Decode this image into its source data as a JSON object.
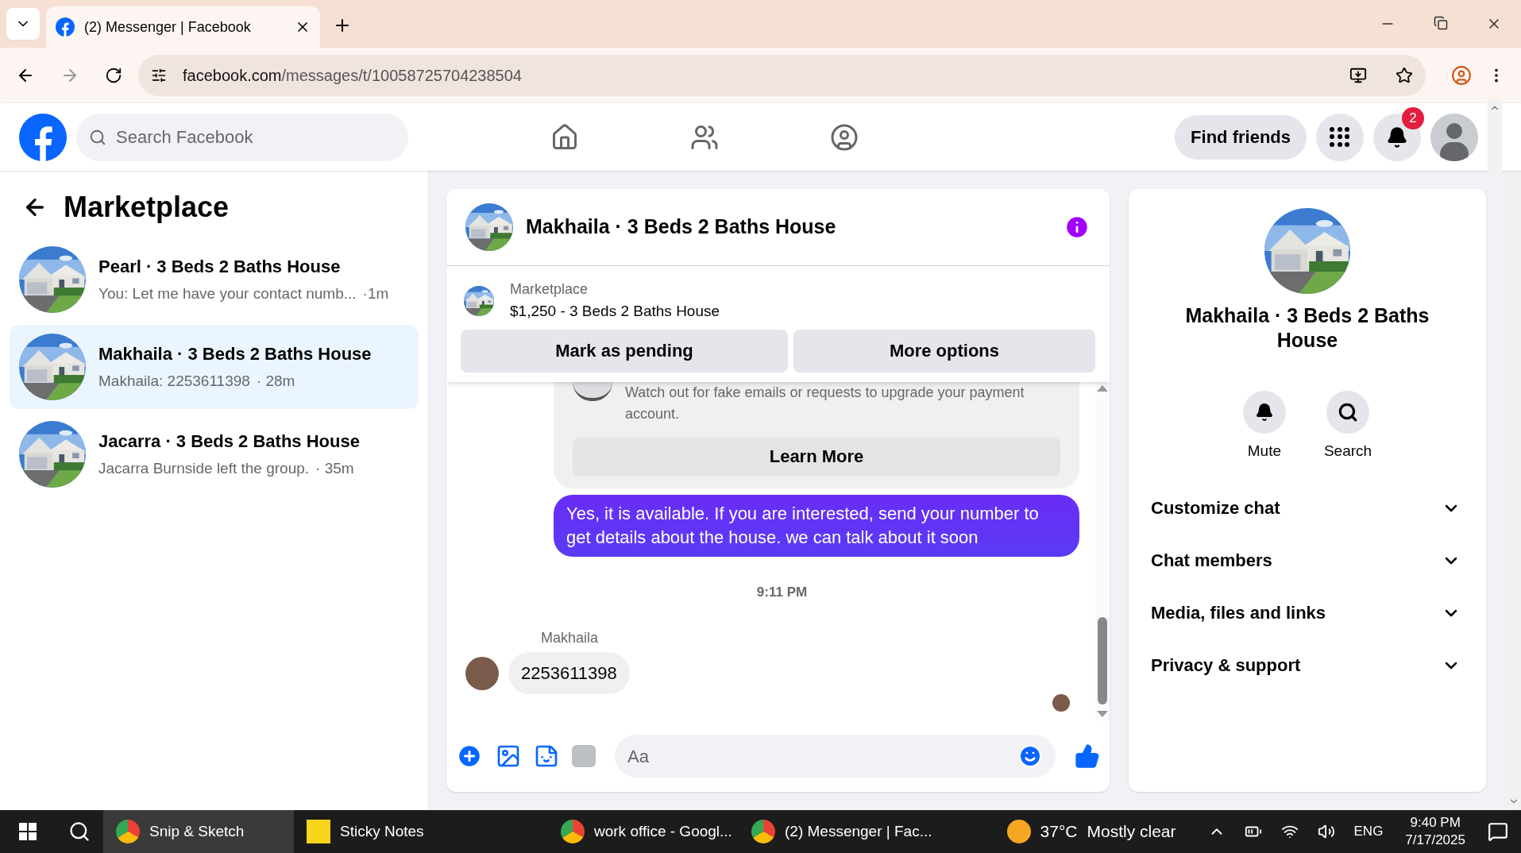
{
  "browser": {
    "tab_title": "(2) Messenger | Facebook",
    "url_host": "facebook.com",
    "url_path": "/messages/t/10058725704238504"
  },
  "nav": {
    "search": {
      "placeholder": "Search Facebook"
    },
    "find_friends": "Find friends",
    "notifications_badge": "2"
  },
  "sidebar": {
    "title": "Marketplace",
    "conversations": [
      {
        "name": "Pearl · 3 Beds 2 Baths House",
        "preview": "You: Let me have your contact numb...",
        "time": "·1m",
        "selected": false
      },
      {
        "name": "Makhaila · 3 Beds 2 Baths House",
        "preview": "Makhaila: 2253611398",
        "time": "· 28m",
        "selected": true
      },
      {
        "name": "Jacarra · 3 Beds 2 Baths House",
        "preview": "Jacarra Burnside left the group.",
        "time": "· 35m",
        "selected": false
      }
    ]
  },
  "chat": {
    "title": "Makhaila · 3 Beds 2 Baths House",
    "listing": {
      "label": "Marketplace",
      "title": "$1,250 - 3 Beds 2 Baths House"
    },
    "buttons": [
      "Mark as pending",
      "More options"
    ],
    "notice": {
      "text": "Watch out for fake emails or requests to upgrade your payment account.",
      "button": "Learn More"
    },
    "messages": [
      {
        "kind": "sent",
        "text": "Yes, it is available. If you are interested, send your number to get details about the house. we can talk about it soon"
      },
      {
        "kind": "time",
        "text": "9:11 PM"
      },
      {
        "kind": "received",
        "sender": "Makhaila",
        "text": "2253611398"
      }
    ],
    "composer": {
      "placeholder": "Aa"
    }
  },
  "details": {
    "title": "Makhaila · 3 Beds 2 Baths House",
    "actions": [
      "Mute",
      "Search"
    ],
    "sections": [
      {
        "label": "Customize chat",
        "expanded": false
      },
      {
        "label": "Chat members",
        "expanded": false
      },
      {
        "label": "Media, files and links",
        "expanded": false
      },
      {
        "label": "Privacy & support",
        "expanded": false
      }
    ]
  },
  "taskbar": {
    "apps": [
      {
        "label": "Snip & Sketch",
        "selected": true
      },
      {
        "label": "Sticky Notes",
        "selected": false
      },
      {
        "label": "work office - Googl...",
        "selected": false
      },
      {
        "label": "(2) Messenger | Fac...",
        "selected": false
      }
    ],
    "weather": {
      "temp": "37°C",
      "condition": "Mostly clear"
    },
    "language": "ENG",
    "time": "9:40 PM",
    "date": "7/17/2025"
  }
}
